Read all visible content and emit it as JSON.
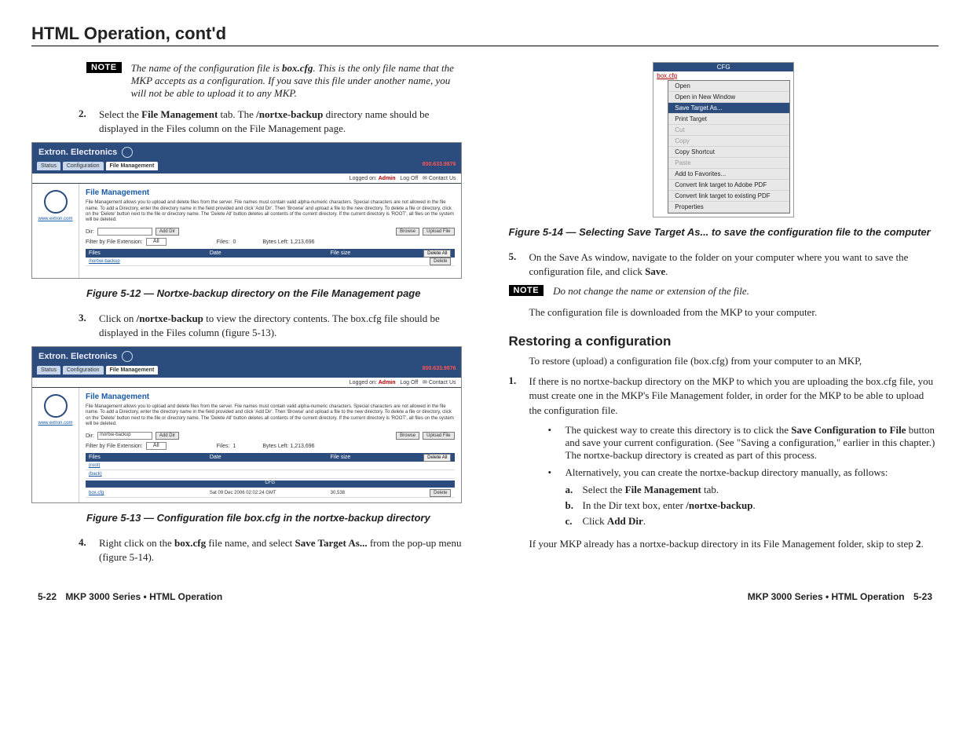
{
  "header": {
    "title": "HTML Operation, cont'd"
  },
  "left": {
    "note1": {
      "label": "NOTE",
      "text_a": "The name of the configuration file is ",
      "text_b": "box.cfg",
      "text_c": ".  This is the only file name that the MKP accepts as a configuration.  If you save this file under another name, you will not be able to upload it to any MKP."
    },
    "step2": {
      "num": "2.",
      "a": "Select the ",
      "b": "File Management",
      "c": " tab.  The ",
      "d": "/nortxe-backup",
      "e": " directory name should be displayed in the Files column on the File Management page."
    },
    "fig12_caption": "Figure 5-12 — Nortxe-backup directory on the File Management page",
    "step3": {
      "num": "3.",
      "a": "Click on ",
      "b": "/nortxe-backup",
      "c": " to view the directory contents.  The box.cfg file should be displayed in the Files column (figure 5-13)."
    },
    "fig13_caption": "Figure 5-13 — Configuration file box.cfg in the nortxe-backup directory",
    "step4": {
      "num": "4.",
      "a": "Right click on the ",
      "b": "box.cfg",
      "c": " file name, and select ",
      "d": "Save Target As...",
      "e": " from the pop-up menu (figure 5-14)."
    },
    "shot12": {
      "brand": "Extron. Electronics",
      "tabs": [
        "Status",
        "Configuration",
        "File Management"
      ],
      "phone": "800.633.9876",
      "logged": "Logged on: ",
      "admin": "Admin",
      "logoff": "Log Off",
      "contact": "Contact Us",
      "sidebar_link": "www.extron.com",
      "fm_title": "File Management",
      "fm_desc": "File Management allows you to upload and delete files from the server. File names must contain valid alpha-numeric characters. Special characters are not allowed in the file name. To add a Directory, enter the directory name in the field provided and click 'Add Dir'. Then 'Browse' and upload a file to the new directory. To delete a file or directory, click on the 'Delete' button next to the file or directory name. The 'Delete All' button deletes all contents of the current directory. If the current directory is 'ROOT', all files on the system will be deleted.",
      "dir_label": "Dir:",
      "add_dir": "Add Dir",
      "browse": "Browse",
      "upload": "Upload File",
      "filter_label": "Filter by File Extension:",
      "filter_val": "All",
      "files_label": "Files:",
      "files_count": "0",
      "bytes_label": "Bytes Left: 1,213,696",
      "col_files": "Files",
      "col_date": "Date",
      "col_size": "File size",
      "col_action": "Delete All",
      "row_link": "/nortxe-backup",
      "row_btn": "Delete"
    },
    "shot13": {
      "dir_value": "/nortxe-backup",
      "files_count": "1",
      "root_link": "(root)",
      "back_link": "(back)",
      "band": "CFG",
      "file_link": "box.cfg",
      "file_date": "Sat 09 Dec 2006 02:02:24 GMT",
      "file_size": "30,538",
      "delete": "Delete"
    }
  },
  "right": {
    "ctx": {
      "topband": "CFG",
      "link": "box.cfg",
      "items": [
        {
          "t": "Open",
          "d": false
        },
        {
          "t": "Open in New Window",
          "d": false
        },
        {
          "t": "Save Target As...",
          "d": false,
          "sel": true
        },
        {
          "t": "Print Target",
          "d": false
        },
        {
          "t": "Cut",
          "d": true
        },
        {
          "t": "Copy",
          "d": true
        },
        {
          "t": "Copy Shortcut",
          "d": false
        },
        {
          "t": "Paste",
          "d": true
        },
        {
          "t": "Add to Favorites...",
          "d": false
        },
        {
          "t": "Convert link target to Adobe PDF",
          "d": false
        },
        {
          "t": "Convert link target to existing PDF",
          "d": false
        },
        {
          "t": "Properties",
          "d": false
        }
      ]
    },
    "fig14_caption": "Figure 5-14 — Selecting Save Target As... to save the configuration file to the computer",
    "step5": {
      "num": "5.",
      "a": "On the Save As window, navigate to the folder on your computer where you want to save the configuration file, and click ",
      "b": "Save",
      "c": "."
    },
    "note2": {
      "label": "NOTE",
      "text": "Do not change the name or extension of the file."
    },
    "after_note": "The configuration file is downloaded from the MKP to your computer.",
    "restore_heading": "Restoring a configuration",
    "restore_intro": "To restore (upload) a configuration file (box.cfg) from your computer to an MKP,",
    "rstep1": {
      "num": "1.",
      "text": "If there is no nortxe-backup directory on the MKP to which you are uploading the box.cfg file, you must create one in the MKP's File Management folder, in order for the MKP to be able to upload the configuration file."
    },
    "bullet1": {
      "a": "The quickest way to create this directory is to click the ",
      "b": "Save Configuration to File",
      "c": " button and save your current configuration.  (See \"Saving a configuration,\" earlier in this chapter.)  The nortxe-backup directory is created as part of this process."
    },
    "bullet2": "Alternatively, you can create the nortxe-backup directory manually, as follows:",
    "sub_a": {
      "l": "a.",
      "a": "Select the ",
      "b": "File Management",
      "c": " tab."
    },
    "sub_b": {
      "l": "b.",
      "a": "In the Dir text box, enter ",
      "b": "/nortxe-backup",
      "c": "."
    },
    "sub_c": {
      "l": "c.",
      "a": "Click ",
      "b": "Add Dir",
      "c": "."
    },
    "closing": {
      "a": "If your MKP already has a nortxe-backup directory in its File Management folder, skip to step ",
      "b": "2",
      "c": "."
    }
  },
  "footer": {
    "left_page": "5-22",
    "right_page": "5-23",
    "running": "MKP 3000 Series • HTML Operation"
  }
}
